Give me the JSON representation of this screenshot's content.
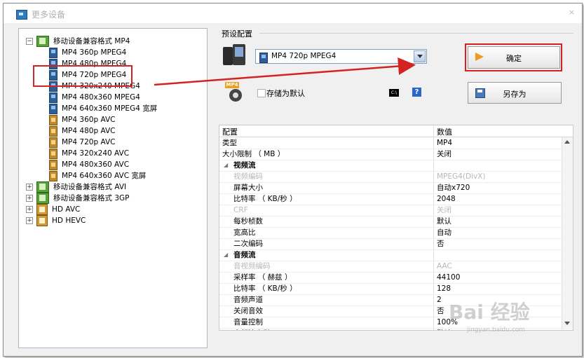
{
  "window": {
    "title": "更多设备",
    "close_glyph": "×"
  },
  "tree": {
    "items": [
      {
        "label": "移动设备兼容格式 MP4",
        "expander": "−"
      },
      {
        "label": "MP4 360p MPEG4"
      },
      {
        "label": "MP4 480p MPEG4"
      },
      {
        "label": "MP4 720p MPEG4"
      },
      {
        "label": "MP4 320x240 MPEG4"
      },
      {
        "label": "MP4 480x360 MPEG4"
      },
      {
        "label": "MP4 640x360 MPEG4 宽屏"
      },
      {
        "label": "MP4 360p AVC"
      },
      {
        "label": "MP4 480p AVC"
      },
      {
        "label": "MP4 720p AVC"
      },
      {
        "label": "MP4 320x240 AVC"
      },
      {
        "label": "MP4 480x360 AVC"
      },
      {
        "label": "MP4 640x360 AVC 宽屏"
      },
      {
        "label": "移动设备兼容格式 AVI",
        "expander": "+"
      },
      {
        "label": "移动设备兼容格式 3GP",
        "expander": "+"
      },
      {
        "label": "HD AVC",
        "expander": "+"
      },
      {
        "label": "HD HEVC",
        "expander": "+"
      }
    ]
  },
  "preset": {
    "group_label": "预设配置",
    "selected": "MP4 720p MPEG4",
    "save_as_default": "存储为默认",
    "cmd_label": "C:\\",
    "help_label": "?",
    "mp4_tag": "MP4"
  },
  "buttons": {
    "ok": "确定",
    "save_as": "另存为"
  },
  "grid": {
    "col_setting": "配置",
    "col_value": "数值",
    "rows": [
      {
        "k": "类型",
        "v": "MP4"
      },
      {
        "k": "大小限制 （ MB ）",
        "v": "关闭"
      },
      {
        "k": "视频流",
        "v": "",
        "section": true
      },
      {
        "k": "视频编码",
        "v": "MPEG4(DivX)",
        "disabled": true
      },
      {
        "k": "屏幕大小",
        "v": "自动x720"
      },
      {
        "k": "比特率 （ KB/秒 ）",
        "v": "2048"
      },
      {
        "k": "CRF",
        "v": "关闭",
        "disabled": true
      },
      {
        "k": "每秒桢数",
        "v": "默认"
      },
      {
        "k": "宽高比",
        "v": "自动"
      },
      {
        "k": "二次编码",
        "v": "否"
      },
      {
        "k": "音频流",
        "v": "",
        "section": true
      },
      {
        "k": "音视频编码",
        "v": "AAC",
        "disabled": true
      },
      {
        "k": "采样率 （ 赫兹 ）",
        "v": "44100"
      },
      {
        "k": "比特率 （ KB/秒 ）",
        "v": "128"
      },
      {
        "k": "音频声道",
        "v": "2"
      },
      {
        "k": "关闭音效",
        "v": "否"
      },
      {
        "k": "音量控制",
        "v": "100%"
      },
      {
        "k": "音频流索引",
        "v": "默认"
      }
    ]
  },
  "watermark": {
    "main": "Bai 经验",
    "sub": "jingyan.baidu.com"
  },
  "colors": {
    "highlight": "#d42222",
    "accent": "#f09a20"
  }
}
